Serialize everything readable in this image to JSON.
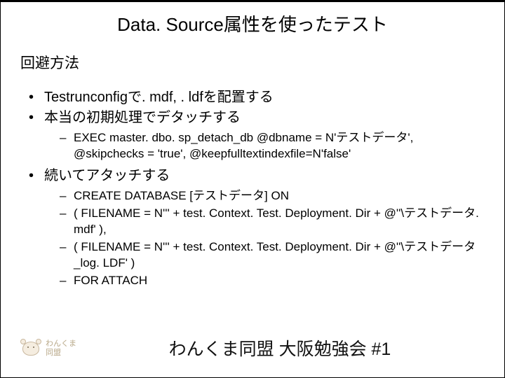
{
  "title": "Data. Source属性を使ったテスト",
  "subtitle": "回避方法",
  "bullets": [
    {
      "text": "Testrunconfigで. mdf, . ldfを配置する"
    },
    {
      "text": "本当の初期処理でデタッチする",
      "sub": [
        "EXEC master. dbo. sp_detach_db @dbname = N'テストデータ', @skipchecks = 'true', @keepfulltextindexfile=N'false'"
      ]
    },
    {
      "text": "続いてアタッチする",
      "sub": [
        "CREATE DATABASE [テストデータ] ON",
        "( FILENAME = N''' + test. Context. Test. Deployment. Dir + @''\\テストデータ. mdf' ),",
        "( FILENAME = N''' + test. Context. Test. Deployment. Dir + @''\\テストデータ_log. LDF' )",
        " FOR ATTACH"
      ]
    }
  ],
  "footer": {
    "logo_line1": "わんくま",
    "logo_line2": "同盟",
    "text": "わんくま同盟 大阪勉強会 #1"
  }
}
